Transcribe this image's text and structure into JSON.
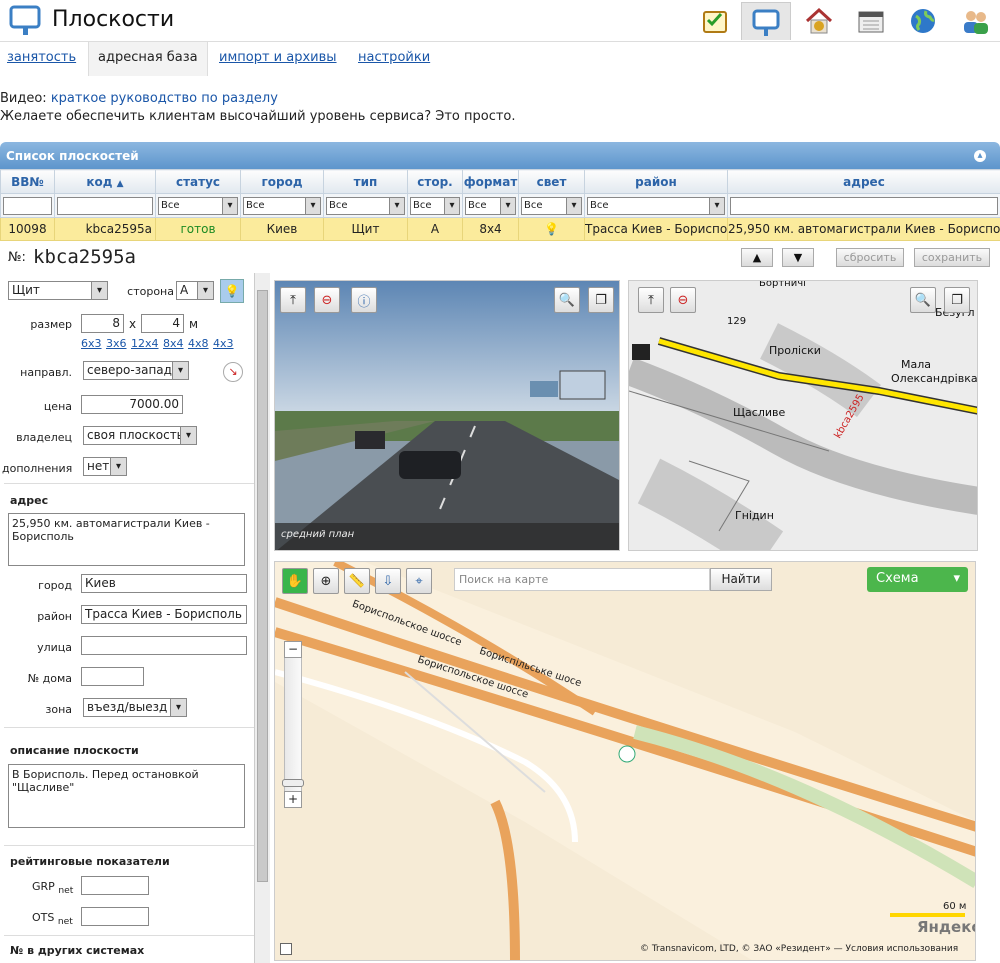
{
  "app": {
    "title": "Плоскости"
  },
  "tabs": [
    "занятость",
    "адресная база",
    "импорт и архивы",
    "настройки"
  ],
  "promo": {
    "video_prefix": "Видео:",
    "video_link": "краткое руководство по разделу",
    "line2": "Желаете обеспечить клиентам высочайший уровень сервиса?",
    "line2_link": "Это просто",
    "dot": "."
  },
  "panel": {
    "title": "Список плоскостей"
  },
  "columns": [
    "BB№",
    "код",
    "статус",
    "город",
    "тип",
    "стор.",
    "формат",
    "свет",
    "район",
    "адрес"
  ],
  "filter_all": "Все",
  "row": {
    "id": "10098",
    "code": "kbca2595a",
    "status": "готов",
    "city": "Киев",
    "type": "Щит",
    "side": "А",
    "format": "8x4",
    "district": "Трасса Киев - Борисполь",
    "address": "25,950 км. автомагистрали Киев - Борисполь"
  },
  "record": {
    "no_label": "№:",
    "code": "kbca2595a",
    "reset": "сбросить",
    "save": "сохранить",
    "type": "Щит",
    "side_label": "сторона",
    "side": "А",
    "size_label": "размер",
    "w": "8",
    "x": "x",
    "h": "4",
    "unit": "м",
    "presets": [
      "6x3",
      "3x6",
      "12x4",
      "8x4",
      "4x8",
      "4x3"
    ],
    "dir_label": "направл.",
    "dir": "северо-запад",
    "price_label": "цена",
    "price": "7000.00",
    "owner_label": "владелец",
    "owner": "своя плоскость",
    "extra_label": "дополнения",
    "extra": "нет",
    "addr_section": "адрес",
    "addr": "25,950 км. автомагистрали Киев - Борисполь",
    "city_label": "город",
    "city": "Киев",
    "district_label": "район",
    "district": "Трасса Киев - Борисполь",
    "street_label": "улица",
    "house_label": "№ дома",
    "zone_label": "зона",
    "zone": "въезд/выезд",
    "desc_section": "описание плоскости",
    "desc": "В Борисполь. Перед остановкой \"Щасливе\"",
    "rating_section": "рейтинговые показатели",
    "grp": "GRP",
    "ots": "OTS",
    "net": "net",
    "other_section": "№ в других системах"
  },
  "photo": {
    "caption": "средний план"
  },
  "schema": {
    "labels": [
      "Бортничі",
      "129",
      "Проліски",
      "Мала",
      "Олександрівка",
      "Щасливе",
      "Гнідин",
      "Безугл",
      "kbca2595"
    ]
  },
  "map": {
    "search_placeholder": "Поиск на карте",
    "find": "Найти",
    "mode": "Схема",
    "road1": "Бориспольское шоссе",
    "road2": "Бориспільське шосе",
    "road3": "Бориспольское шоссе",
    "scale": "60 м",
    "brand": "Яндекс",
    "copyright": "© Transnavicom, LTD, © ЗАО «Резидент» —",
    "terms": "Условия использования"
  }
}
